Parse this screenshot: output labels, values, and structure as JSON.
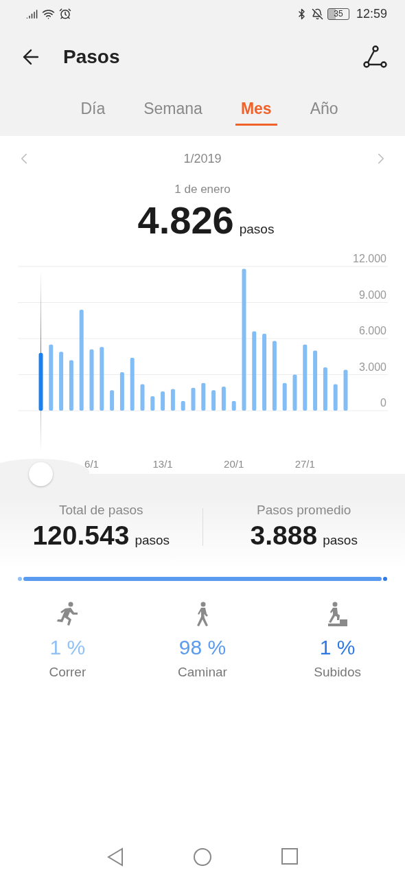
{
  "status_bar": {
    "battery": "35",
    "time": "12:59"
  },
  "header": {
    "title": "Pasos"
  },
  "tabs": [
    {
      "label": "Día",
      "selected": false
    },
    {
      "label": "Semana",
      "selected": false
    },
    {
      "label": "Mes",
      "selected": true
    },
    {
      "label": "Año",
      "selected": false
    }
  ],
  "period": {
    "label": "1/2019"
  },
  "selection": {
    "date": "1 de enero",
    "value": "4.826",
    "unit": "pasos"
  },
  "chart_data": {
    "type": "bar",
    "grid": true,
    "categories": [
      null,
      null,
      null,
      null,
      null,
      "6/1",
      null,
      null,
      null,
      null,
      null,
      null,
      "13/1",
      null,
      null,
      null,
      null,
      null,
      null,
      "20/1",
      null,
      null,
      null,
      null,
      null,
      null,
      "27/1",
      null,
      null,
      null,
      null
    ],
    "values": [
      4800,
      5500,
      4900,
      4200,
      8400,
      5100,
      5300,
      1700,
      3200,
      4400,
      2200,
      1200,
      1600,
      1800,
      800,
      1900,
      2300,
      1700,
      2000,
      800,
      11800,
      6600,
      6400,
      5800,
      2300,
      3000,
      5500,
      5000,
      3600,
      2200,
      3400
    ],
    "ylim": [
      0,
      12000
    ],
    "yticks": [
      {
        "value": 12000,
        "label": "12.000"
      },
      {
        "value": 9000,
        "label": "9.000"
      },
      {
        "value": 6000,
        "label": "6.000"
      },
      {
        "value": 3000,
        "label": "3.000"
      },
      {
        "value": 0,
        "label": "0"
      }
    ]
  },
  "summary": [
    {
      "label": "Total de pasos",
      "value": "120.543",
      "unit": "pasos"
    },
    {
      "label": "Pasos promedio",
      "value": "3.888",
      "unit": "pasos"
    }
  ],
  "activities": [
    {
      "kind": "run",
      "percent": "1 %",
      "label": "Correr",
      "color": "#8fc1f6"
    },
    {
      "kind": "walk",
      "percent": "98 %",
      "label": "Caminar",
      "color": "#5b9bef"
    },
    {
      "kind": "climb",
      "percent": "1 %",
      "label": "Subidos",
      "color": "#2f79e4"
    }
  ]
}
